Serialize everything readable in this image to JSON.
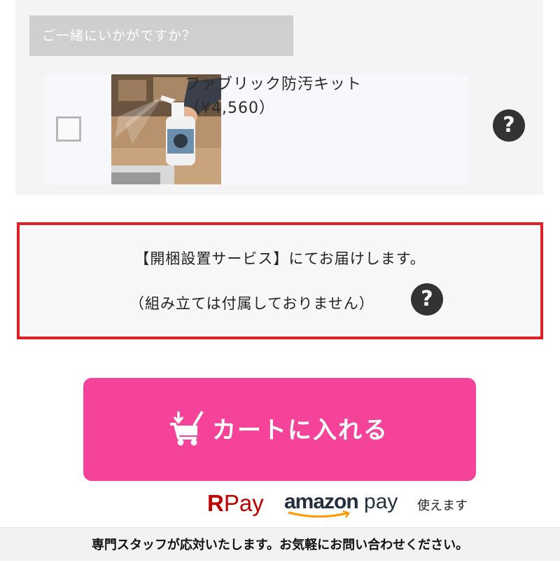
{
  "upsell": {
    "heading": "ご一緒にいかがですか？",
    "item": {
      "name": "ファブリック防汚キット（¥4,560）",
      "image_alt": "fabric-protector-spray-photo",
      "checked": false
    },
    "help_icon": "question-circle-icon"
  },
  "notice": {
    "line1": "【開梱設置サービス】にてお届けします。",
    "line2": "（組み立ては付属しておりません）",
    "help_icon": "question-circle-icon"
  },
  "cart_button": {
    "label": "カートに入れる",
    "icon": "cart-download-icon",
    "color": "#f5439a"
  },
  "payments": {
    "rpay": {
      "r": "R",
      "text": "Pay"
    },
    "amazon": {
      "brand": "amazon",
      "text": "pay"
    },
    "suffix": "使えます"
  },
  "footer": {
    "text": "専門スタッフが応対いたします。お気軽にお問い合わせください。"
  },
  "colors": {
    "accent_pink": "#f5439a",
    "notice_border_red": "#e01e26",
    "rpay_red": "#bf0000",
    "amazon_orange": "#ff9900"
  }
}
